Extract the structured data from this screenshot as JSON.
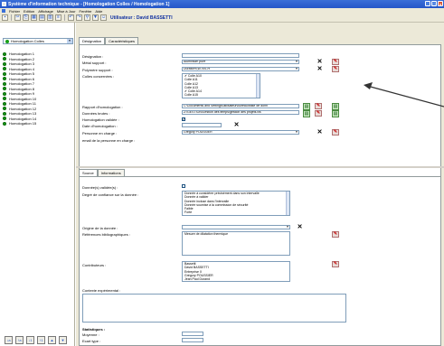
{
  "window": {
    "title": "Système d'information technique - [Homologation Colles / Homologation 1]",
    "minimize": "_",
    "maximize": "□",
    "close": "x"
  },
  "menu": [
    "Fichier",
    "Edition",
    "Affichage",
    "Mise à Jour",
    "Fenêtre",
    "Aide"
  ],
  "toolbar": {
    "user_label": "Utilisateur : David BASSETTI"
  },
  "left": {
    "combo_value": "Homologation Colles",
    "tree_items": [
      "Homologation 1",
      "Homologation 2",
      "Homologation 3",
      "Homologation 4",
      "Homologation 5",
      "Homologation 6",
      "Homologation 7",
      "Homologation 8",
      "Homologation 9",
      "Homologation 10",
      "Homologation 11",
      "Homologation 12",
      "Homologation 13",
      "Homologation 14",
      "Homologation 15"
    ]
  },
  "tabs_top": [
    "Désignation",
    "Caractéristiques"
  ],
  "form_top": {
    "designation_label": "Désignation :",
    "metal_label": "Métal support :",
    "metal_value": "Aluminium pure",
    "polymere_label": "Polymère support :",
    "polymere_value": "Duraform,W-ViS-H",
    "colles_label": "Colles concernées :",
    "colles_list": [
      "✔ Colle A10",
      "Colle A11",
      "Colle A12",
      "Colle A13",
      "✔ Colle A14",
      "Colle A15"
    ],
    "rapport_label": "Rapport d'homologation :",
    "rapport_value": "C:\\Documents and Settings\\utilisateur\\Bureau\\base de donn",
    "donnees_label": "Données brutes :",
    "donnees_value": "Z:\\GESTION\\Gestion des temps\\gestion des projets.xls",
    "validee_label": "Homologation validée :",
    "validee_value": "✔",
    "date_label": "Date d'homologation :",
    "personne_label": "Personne en charge :",
    "personne_value": "Grégory POUSSIER",
    "email_label": "email de la personne en charge :"
  },
  "tabs_bot": [
    "Source",
    "Informations"
  ],
  "form_bot": {
    "validees_label": "Donnée(s) validée(s) :",
    "confiance_label": "Degré de confiance sur la donnée :",
    "confiance_list": [
      "Donnée à considérer précisément dans son intervalle",
      "Donnée à valider",
      "Donnée incluse dans l'intervalle",
      "Donnée soumise à la commission de sécurité",
      "Faible",
      "Forte"
    ],
    "origine_label": "Origine de la donnée :",
    "refs_label": "Références bibliographiques :",
    "refs_list": [
      "Mesure de dilatation thermique"
    ],
    "contrib_label": "Contributeurs :",
    "contrib_list": [
      "Bassetti",
      "David BASSETTI",
      "Entreprise X",
      "Grégory POUSSIER",
      "Jean Paul Durand"
    ],
    "contexte_label": "Contexte expérimental :",
    "stats_label": "Statistiques :",
    "moyenne_label": "Moyenne :",
    "ecart_label": "Ecart type :"
  },
  "icons": {
    "delete": "✕",
    "edit": "✎",
    "open": "▤"
  }
}
